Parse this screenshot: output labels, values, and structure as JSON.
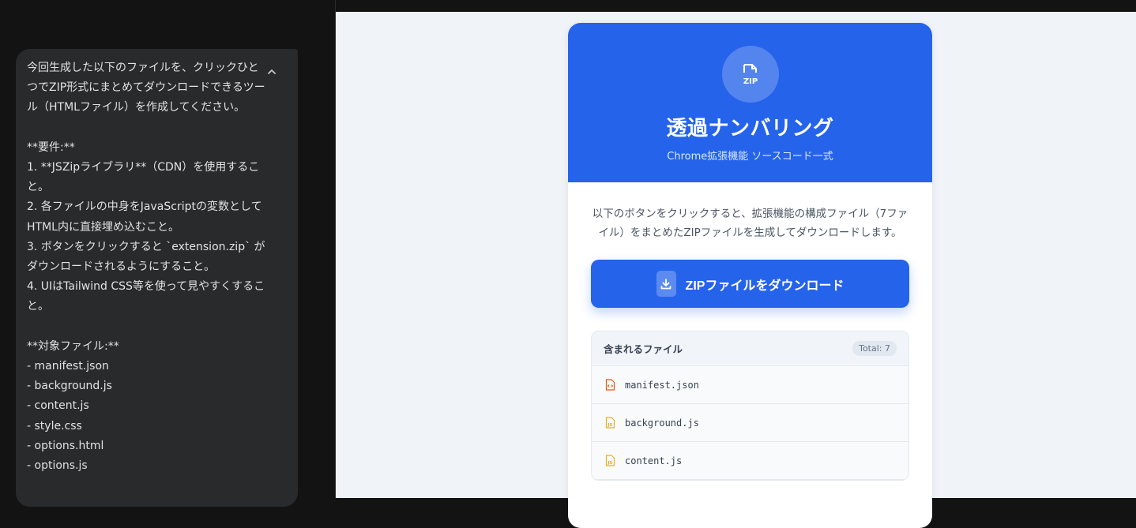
{
  "prompt": {
    "text": "今回生成した以下のファイルを、クリックひとつでZIP形式にまとめてダウンロードできるツール（HTMLファイル）を作成してください。\n\n**要件:**\n1. **JSZipライブラリ**（CDN）を使用すること。\n2. 各ファイルの中身をJavaScriptの変数としてHTML内に直接埋め込むこと。\n3. ボタンをクリックすると `extension.zip` がダウンロードされるようにすること。\n4. UIはTailwind CSS等を使って見やすくすること。\n\n**対象ファイル:**\n- manifest.json\n- background.js\n- content.js\n- style.css\n- options.html\n- options.js"
  },
  "card": {
    "zip_icon_text": "ZIP",
    "title": "透過ナンバリング",
    "subtitle": "Chrome拡張機能 ソースコード一式",
    "description": "以下のボタンをクリックすると、拡張機能の構成ファイル（7ファイル）をまとめたZIPファイルを生成してダウンロードします。",
    "download_label": "ZIPファイルをダウンロード",
    "files_title": "含まれるファイル",
    "total_badge": "Total: 7",
    "files": [
      {
        "name": "manifest.json",
        "icon": "code-file-icon",
        "color": "#ea580c"
      },
      {
        "name": "background.js",
        "icon": "js-file-icon",
        "color": "#eab308"
      },
      {
        "name": "content.js",
        "icon": "js-file-icon",
        "color": "#eab308"
      }
    ]
  },
  "colors": {
    "primary": "#2563eb",
    "json_file": "#ea580c",
    "js_file": "#eab308"
  }
}
